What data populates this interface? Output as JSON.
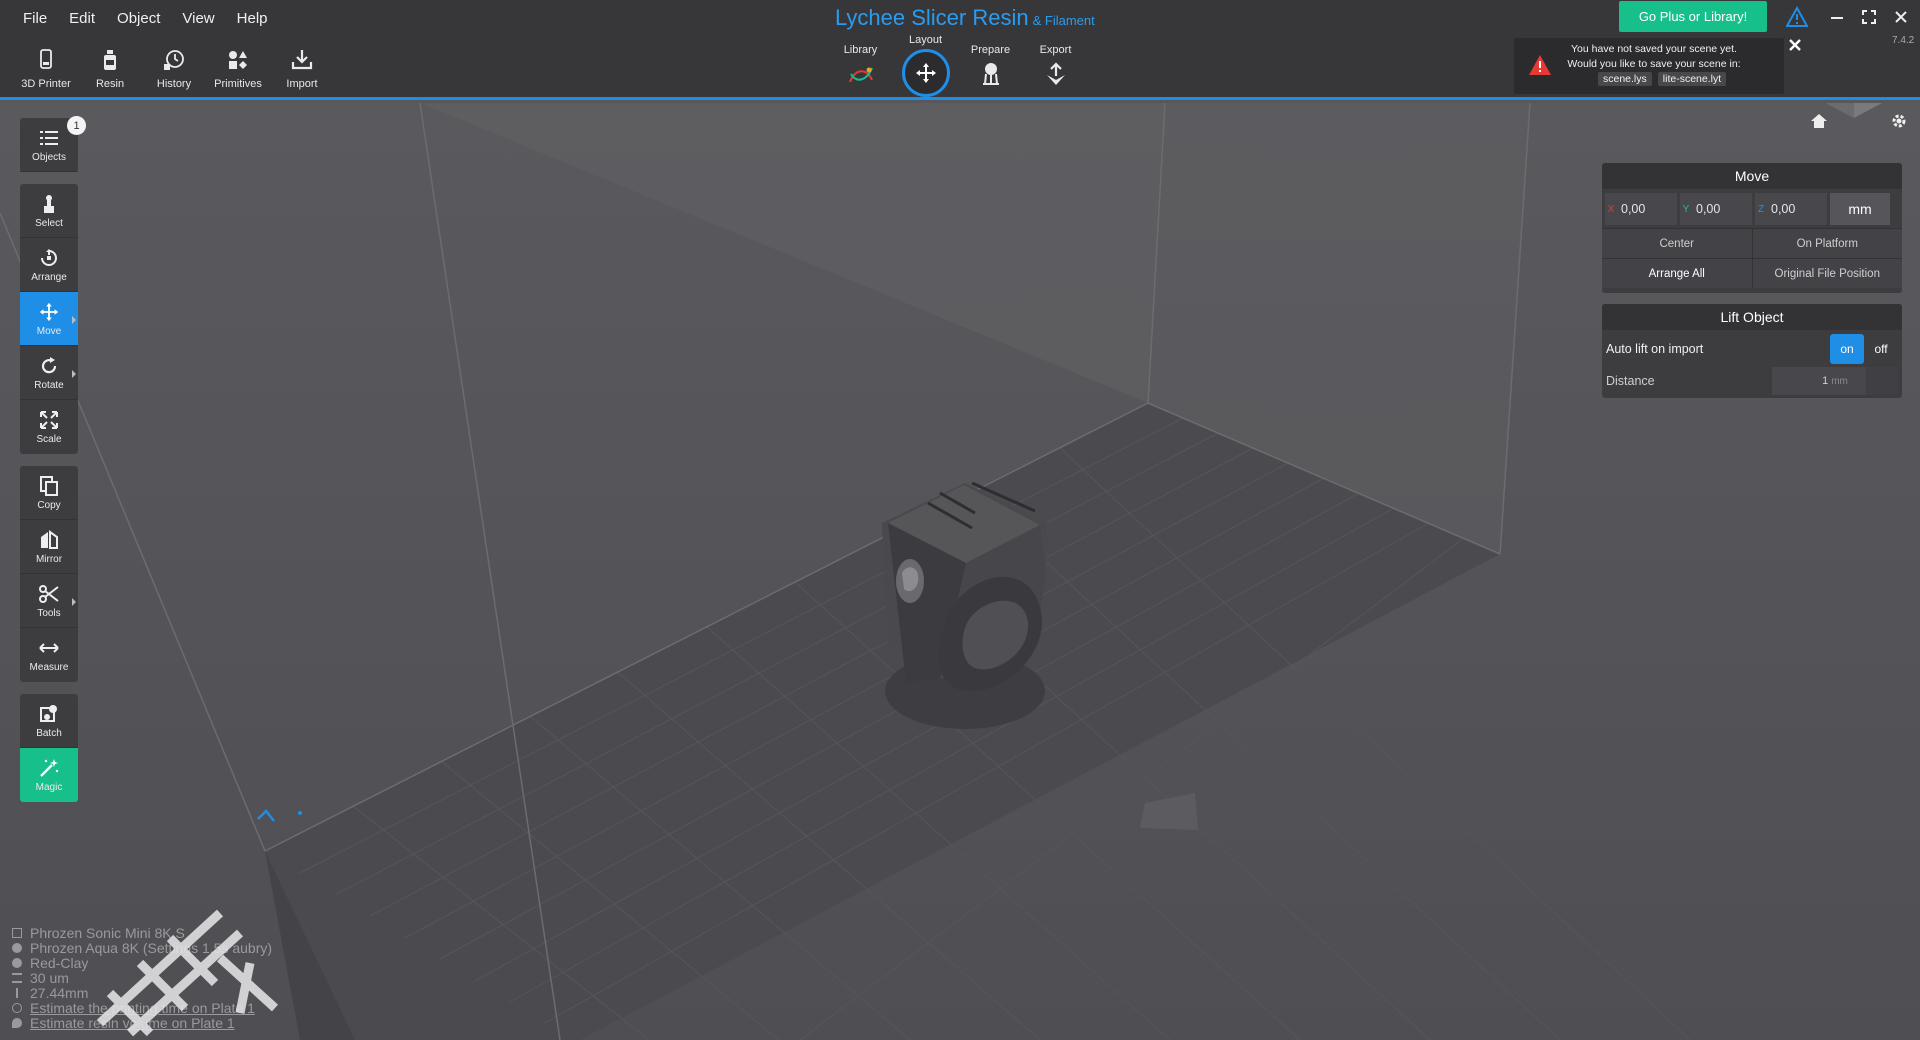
{
  "menu": [
    "File",
    "Edit",
    "Object",
    "View",
    "Help"
  ],
  "app": {
    "title": "Lychee Slicer Resin",
    "subtitle": "& Filament",
    "version": "7.4.2"
  },
  "left_tools": [
    {
      "label": "3D Printer",
      "icon": "printer-icon"
    },
    {
      "label": "Resin",
      "icon": "resin-bottle-icon"
    },
    {
      "label": "History",
      "icon": "history-icon"
    },
    {
      "label": "Primitives",
      "icon": "primitives-icon"
    },
    {
      "label": "Import",
      "icon": "import-icon"
    }
  ],
  "workflow": {
    "library": "Library",
    "layout": "Layout",
    "prepare": "Prepare",
    "export": "Export",
    "active": "Layout"
  },
  "go_plus": "Go Plus or Library!",
  "save_notice": {
    "message": "You have not saved your scene yet. Would you like to save your scene in:",
    "options": [
      "scene.lys",
      "lite-scene.lyt"
    ]
  },
  "side_tools": {
    "objects": {
      "label": "Objects",
      "count": "1"
    },
    "select": "Select",
    "arrange": "Arrange",
    "move": "Move",
    "rotate": "Rotate",
    "scale": "Scale",
    "copy": "Copy",
    "mirror": "Mirror",
    "tools": "Tools",
    "measure": "Measure",
    "batch": "Batch",
    "magic": "Magic"
  },
  "move_panel": {
    "title": "Move",
    "x": {
      "axis": "X",
      "value": "0,00"
    },
    "y": {
      "axis": "Y",
      "value": "0,00"
    },
    "z": {
      "axis": "Z",
      "value": "0,00"
    },
    "unit": "mm",
    "center": "Center",
    "on_platform": "On Platform",
    "arrange_all": "Arrange All",
    "original_position": "Original File Position"
  },
  "lift_panel": {
    "title": "Lift Object",
    "auto_lift_label": "Auto lift on import",
    "on": "on",
    "off": "off",
    "distance_label": "Distance",
    "distance_value": "1",
    "distance_unit": "mm"
  },
  "info": {
    "printer": "Phrozen Sonic Mini 8K S",
    "resin": "Phrozen Aqua 8K (Settings 1.5s aubry)",
    "color": "Red-Clay",
    "layer": "30 um",
    "height": "27.44mm",
    "estimate_time": "Estimate the printing time on Plate 1",
    "estimate_volume": "Estimate resin volume on Plate 1"
  },
  "colors": {
    "accent": "#1e8ee6",
    "magic": "#17c08a",
    "go_plus": "#17c08a",
    "warning": "#e53935"
  }
}
